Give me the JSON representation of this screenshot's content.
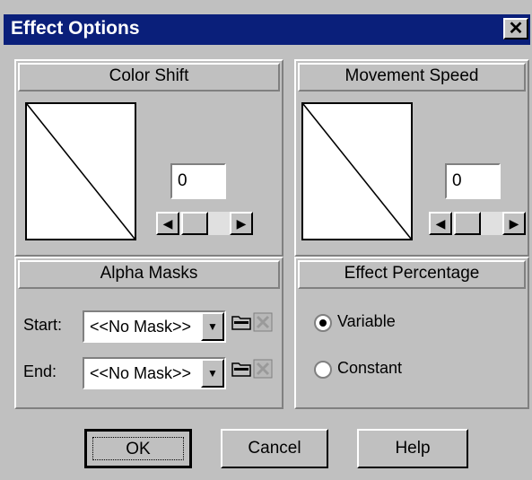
{
  "window": {
    "title": "Effect Options",
    "close_label": "✕"
  },
  "color_shift": {
    "header": "Color Shift",
    "value": "0"
  },
  "movement_speed": {
    "header": "Movement Speed",
    "value": "0"
  },
  "alpha_masks": {
    "header": "Alpha Masks",
    "start_label": "Start:",
    "start_value": "<<No Mask>>",
    "end_label": "End:",
    "end_value": "<<No Mask>>"
  },
  "effect_percentage": {
    "header": "Effect Percentage",
    "options": [
      {
        "label": "Variable",
        "selected": true
      },
      {
        "label": "Constant",
        "selected": false
      }
    ]
  },
  "buttons": {
    "ok": "OK",
    "cancel": "Cancel",
    "help": "Help"
  }
}
